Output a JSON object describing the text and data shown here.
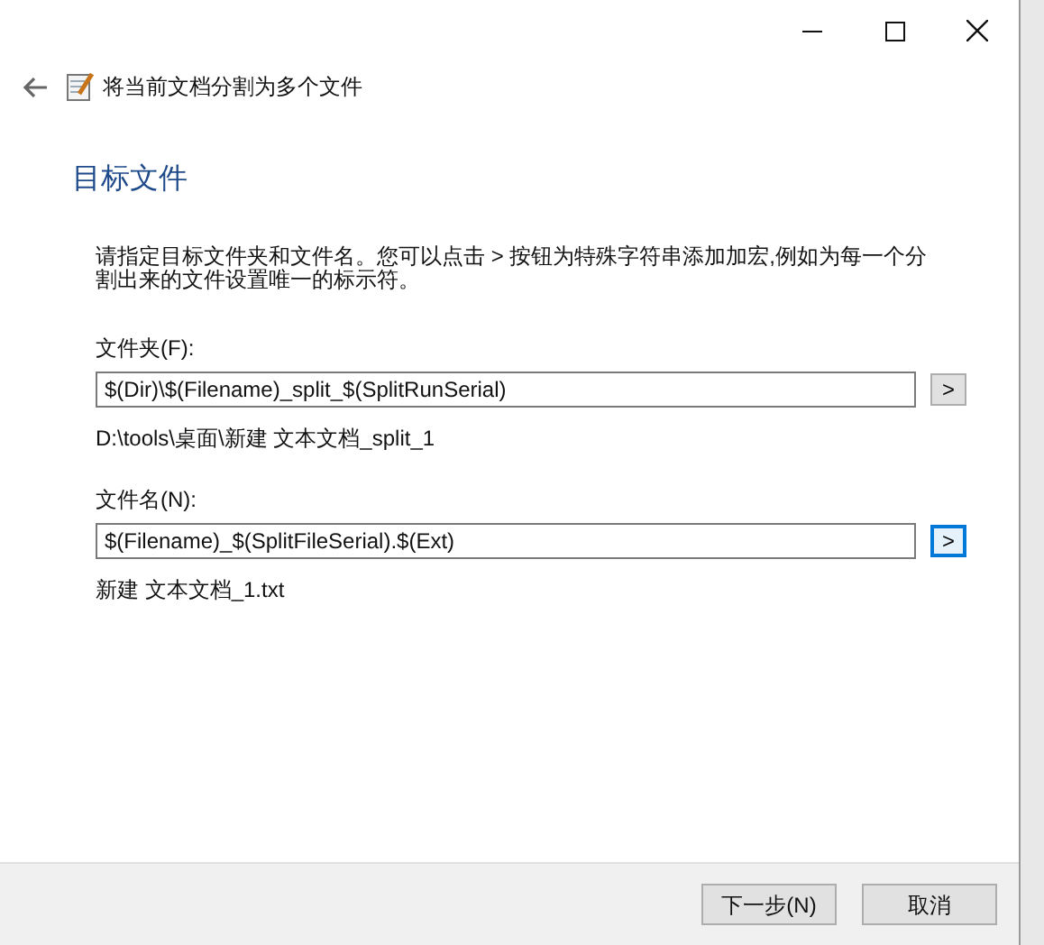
{
  "window": {
    "title": "将当前文档分割为多个文件"
  },
  "heading": "目标文件",
  "description": "请指定目标文件夹和文件名。您可以点击 > 按钮为特殊字符串添加加宏,例如为每一个分割出来的文件设置唯一的标示符。",
  "fields": [
    {
      "label": "文件夹(F):",
      "value": "$(Dir)\\$(Filename)_split_$(SplitRunSerial)",
      "button": ">",
      "button_focused": false,
      "preview": "D:\\tools\\桌面\\新建 文本文档_split_1"
    },
    {
      "label": "文件名(N):",
      "value": "$(Filename)_$(SplitFileSerial).$(Ext)",
      "button": ">",
      "button_focused": true,
      "preview": "新建 文本文档_1.txt"
    }
  ],
  "buttons": [
    {
      "label": "下一步(N)"
    },
    {
      "label": "取消"
    }
  ]
}
